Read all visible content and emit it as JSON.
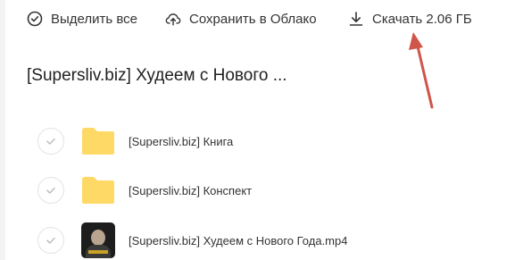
{
  "toolbar": {
    "select_all_label": "Выделить все",
    "save_cloud_label": "Сохранить в Облако",
    "download_label": "Скачать 2.06 ГБ"
  },
  "folder": {
    "title": "[Supersliv.biz] Худеем с Нового ..."
  },
  "files": [
    {
      "name": "[Supersliv.biz] Книга",
      "type": "folder"
    },
    {
      "name": "[Supersliv.biz] Конспект",
      "type": "folder"
    },
    {
      "name": "[Supersliv.biz] Худеем с Нового Года.mp4",
      "type": "video"
    }
  ],
  "colors": {
    "folder": "#FFD966",
    "arrow": "#d0554a",
    "text": "#333333"
  },
  "icons": {
    "select_all": "check-circle-icon",
    "save_cloud": "cloud-upload-icon",
    "download": "download-icon"
  }
}
